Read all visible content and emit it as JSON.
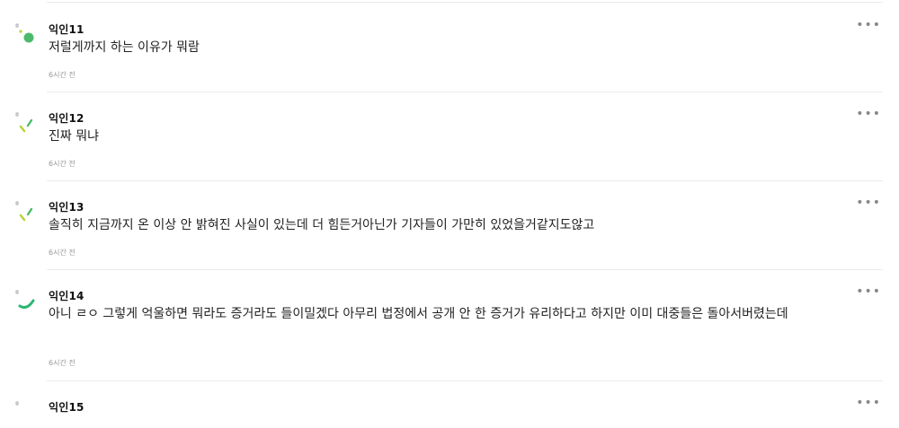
{
  "comments": [
    {
      "author": "익인11",
      "text": "저럴게까지 하는 이유가 뭐람",
      "time": "6시간 전",
      "more": "•••",
      "avatar_color": "#4dba6b"
    },
    {
      "author": "익인12",
      "text": "진짜 뭐냐",
      "time": "6시간 전",
      "more": "•••",
      "avatar_color": "#b5d53b"
    },
    {
      "author": "익인13",
      "text": "솔직히 지금까지 온 이상 안 밝혀진 사실이 있는데 더 힘든거아닌가 기자들이 가만히 있었을거같지도않고",
      "time": "6시간 전",
      "more": "•••",
      "avatar_color": "#b5d53b"
    },
    {
      "author": "익인14",
      "text": "아니 ㄹㅇ 그렇게 억울하면 뭐라도 증거라도 들이밀겠다 아무리 법정에서 공개 안 한 증거가 유리하다고 하지만 이미 대중들은 돌아서버렸는데",
      "time": "6시간 전",
      "more": "•••",
      "avatar_color": "#2bb673"
    },
    {
      "author": "익인15",
      "text": "",
      "time": "",
      "more": "•••",
      "avatar_color": "#4dba6b"
    }
  ]
}
